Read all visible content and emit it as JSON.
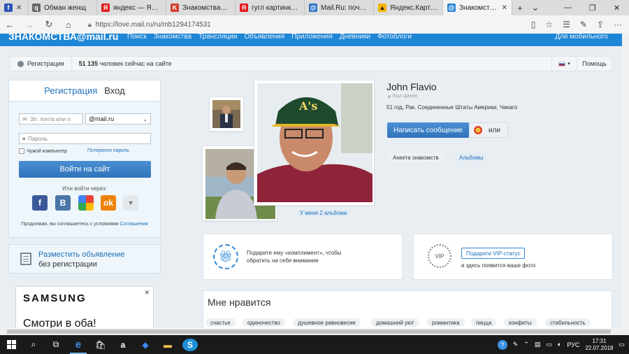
{
  "browser": {
    "tabs": [
      {
        "label": "",
        "favicon_color": "#2a55b4",
        "favicon": "f"
      },
      {
        "label": "Обман женщ",
        "favicon_color": "#555555",
        "favicon": "q"
      },
      {
        "label": "яндекс — Яндекс:",
        "favicon_color": "#e31b1b",
        "favicon": "Я"
      },
      {
        "label": "Знакомства@mail",
        "favicon_color": "#d23c2a",
        "favicon": "K"
      },
      {
        "label": "гугл картинки — Я",
        "favicon_color": "#e31b1b",
        "favicon": "Я"
      },
      {
        "label": "Mail.Ru: почта, пои",
        "favicon_color": "#2b73c5",
        "favicon": "@"
      },
      {
        "label": "Яндекс.Картинки:",
        "favicon_color": "#f5b400",
        "favicon": "▲"
      },
      {
        "label": "Знакомства@",
        "favicon_color": "#2d86d9",
        "favicon": "@",
        "active": true
      }
    ],
    "url": "https://love.mail.ru/ru/mb1294174531"
  },
  "site": {
    "brand": "ЗНАКОМСТВА@mail.ru",
    "menu": [
      "Поиск",
      "Знакомства",
      "Трансляции",
      "Объявления",
      "Приложения",
      "Дневники",
      "Фотоблоги"
    ],
    "mobile": "Для мобильного",
    "registration_link": "Регистрация",
    "online_count": "51 135",
    "online_text": "человек сейчас на сайте",
    "help": "Помощь"
  },
  "login": {
    "tab_register": "Регистрация",
    "tab_login": "Вход",
    "email_placeholder": "Эл. почта или л",
    "domain": "@mail.ru",
    "password_placeholder": "Пароль",
    "foreign_pc": "Чужой компьютер",
    "forgot": "Потерялся пароль",
    "submit": "Войти на сайт",
    "or_via": "Или войти через:",
    "terms_prefix": "Продолжая, вы соглашаетесь с условиями",
    "terms_link": "Соглашения"
  },
  "announce": {
    "line1": "Разместить объявление",
    "line2": "без регистрации"
  },
  "ad": {
    "brand": "SAMSUNG",
    "slogan": "Смотри в оба!"
  },
  "profile": {
    "name": "John Flavio",
    "seen": "Был давно",
    "info": "51 год, Рак. Соединенные Штаты Америки, Чикаго",
    "write_button": "Написать сообщение",
    "or": "или",
    "tab_anketa": "Анкета знакомств",
    "tab_albums": "Альбомы",
    "albums_link": "У меня 2 альбома"
  },
  "promo": {
    "gift_text1": "Подарите ему «комплимент», чтобы",
    "gift_text2": "обратить на себя внимание",
    "vip_button": "Подарите VIP-статус",
    "vip_text": "и здесь появится ваше фото",
    "vip_badge": "VIP"
  },
  "likes": {
    "title": "Мне нравится",
    "chips": [
      "счастье",
      "одиночество",
      "душевное равновесие",
      "домашний уют",
      "романтика",
      "пицца",
      "конфеты",
      "стабильность"
    ]
  },
  "taskbar": {
    "lang": "РУС",
    "time": "17:31",
    "date": "22.07.2018"
  },
  "colors": {
    "site_blue": "#1f86d6",
    "link_blue": "#1d6fb8",
    "button_blue": "#3a7fc4"
  }
}
